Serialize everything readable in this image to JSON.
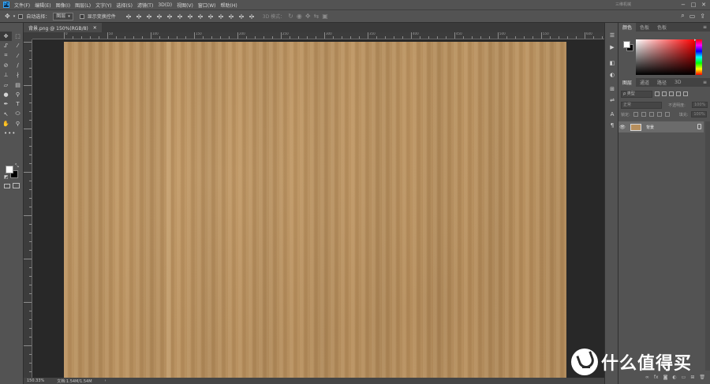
{
  "app": {
    "logo_text": "Ps"
  },
  "menubar": {
    "items": [
      "文件(F)",
      "编辑(E)",
      "图像(I)",
      "图层(L)",
      "文字(Y)",
      "选择(S)",
      "滤镜(T)",
      "3D(D)",
      "视图(V)",
      "窗口(W)",
      "帮助(H)"
    ],
    "right_text": "三维机械",
    "window_controls": [
      "−",
      "□",
      "✕"
    ]
  },
  "options": {
    "auto_select_label": "自动选择：",
    "auto_select_value": "图层",
    "show_transform_label": "显示变换控件",
    "mode3d_label": "3D 模式："
  },
  "document": {
    "tab_title": "背景.png @ 150%(RGB/8)",
    "zoom_status": "150.33%",
    "doc_status": "文档:1.54M/1.54M",
    "ruler_labels": [
      "0",
      "50",
      "100",
      "150",
      "200",
      "250",
      "300",
      "350",
      "400",
      "450",
      "500",
      "550",
      "600",
      "650"
    ]
  },
  "color_panel": {
    "tabs": [
      "颜色",
      "色板",
      "色板"
    ]
  },
  "layers_panel": {
    "tabs": [
      "图层",
      "通道",
      "路径",
      "3D"
    ],
    "filter_placeholder": "ρ 类型",
    "blend_mode": "正常",
    "opacity_label": "不透明度:",
    "opacity_value": "100%",
    "lock_label": "锁定:",
    "fill_label": "填充:",
    "fill_value": "100%",
    "layer_name": "背景"
  },
  "watermark": {
    "text": "什么值得买"
  },
  "colors": {
    "canvas": "#b9915f",
    "panel_bg": "#535353",
    "workspace": "#282828",
    "accent": "#31a8ff"
  }
}
